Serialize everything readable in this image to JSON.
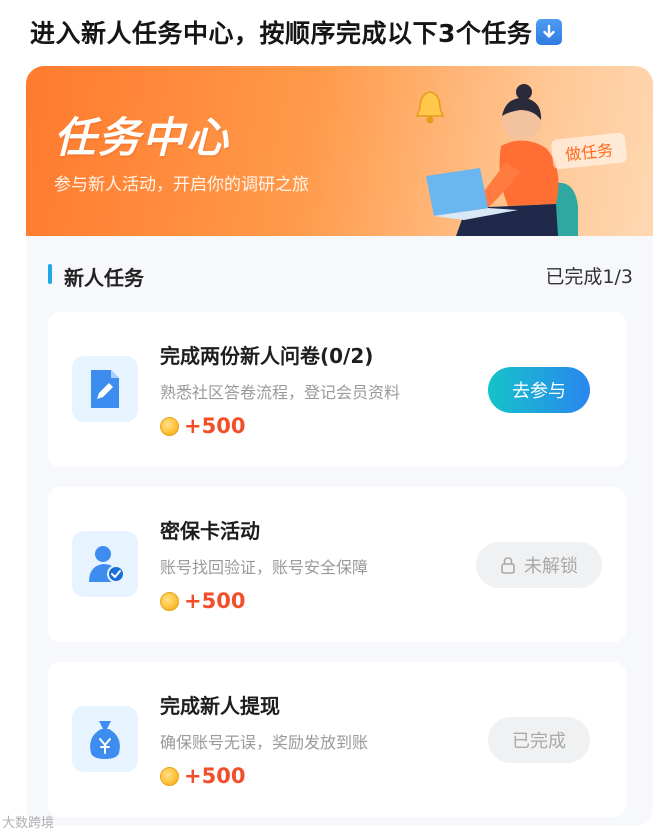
{
  "heading": "进入新人任务中心，按顺序完成以下3个任务",
  "banner": {
    "title": "任务中心",
    "subtitle": "参与新人活动，开启你的调研之旅",
    "action_label": "做任务"
  },
  "section": {
    "title": "新人任务",
    "progress": "已完成1/3"
  },
  "tasks": [
    {
      "title": "完成两份新人问卷(0/2)",
      "description": "熟悉社区答卷流程，登记会员资料",
      "reward": "+500",
      "action_label": "去参与",
      "status": "available",
      "icon": "document-pen-icon"
    },
    {
      "title": "密保卡活动",
      "description": "账号找回验证，账号安全保障",
      "reward": "+500",
      "action_label": "未解锁",
      "status": "locked",
      "icon": "user-check-icon"
    },
    {
      "title": "完成新人提现",
      "description": "确保账号无误，奖励发放到账",
      "reward": "+500",
      "action_label": "已完成",
      "status": "completed",
      "icon": "money-bag-icon"
    }
  ],
  "colors": {
    "banner_start": "#ff7a2e",
    "banner_end": "#ffd8b2",
    "accent_blue": "#20a8e8",
    "reward_red": "#f24e2a",
    "button_gradient_start": "#14c3c9",
    "button_gradient_end": "#2a86f0"
  },
  "watermark": "大数跨境"
}
